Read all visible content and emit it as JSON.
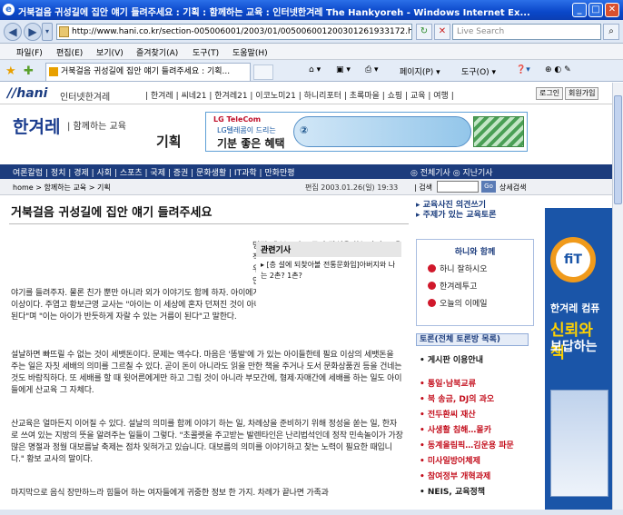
{
  "window": {
    "title": "거북걸음 귀성길에 집안 얘기 들려주세요 : 기획 : 함께하는 교육 : 인터넷한겨레 The Hankyoreh - Windows Internet Ex..."
  },
  "browser": {
    "url": "http://www.hani.co.kr/section-005006001/2003/01/005006001200301261933172.html",
    "search_placeholder": "Live Search",
    "menu": [
      "파일(F)",
      "편집(E)",
      "보기(V)",
      "즐겨찾기(A)",
      "도구(T)",
      "도움말(H)"
    ],
    "tab_title": "거북걸음 귀성길에 집안 얘기 들려주세요 : 기획...",
    "tools": [
      "페이지(P) ▾",
      "도구(O) ▾"
    ]
  },
  "site": {
    "logo": "//hani",
    "logo_sub": "인터넷한겨레",
    "top_links": "| 한겨레 | 씨네21 | 한겨레21 | 이코노미21 | 하니리포터 | 초록마을 | 쇼핑 | 교육 | 여행 |",
    "login": "로그인",
    "join": "회원가입",
    "brand": "한겨레",
    "brand_tag": "| 함께하는 교육",
    "section": "기획",
    "ad": {
      "company": "LG TeleCom",
      "line1": "LG텔레콤이 드리는",
      "line2": "기분 좋은 혜택",
      "circle": "②"
    },
    "categories": "여론칼럼 | 정치 | 경제 | 사회 | 스포츠 | 국제 | 증권 | 문화생활 | IT과학 | 만화만평",
    "cat_right": "◎ 전체기사  ◎ 지난기사",
    "breadcrumb": "home > 함께하는 교육 > 기획",
    "date": "편집 2003.01.26(일) 19:33",
    "search_label": "| 검색",
    "go": "Go",
    "detail_search": "상세검색"
  },
  "article": {
    "headline": "거북걸음 귀성길에 집안 얘기 들려주세요",
    "paragraphs": [
      "명절 때 부모가 조금만 관심을 쏟는다면, 교육적으로 아이들과 유익한 시간을 보낼 수 있다. 우선 차가 막혀 '고생길'이 되는 고향가는 차 안에서 아이들이 어렸을 적 이야기나 집안 이야기를 들려주자. 물론 친가 뿐만 아니라 외가 이야기도 함께 하자. 아이에게 가족이나 조상 이야기는 단순한 흥미거리 이상이다. 주엽고 황보근영 교사는 \"아이는 이 세상에 혼자 던져진 것이 아니라는 것을 알게 되고 공동체 의식을 느끼게 된다\"며 \"이는 아이가 반듯하게 자랄 수 있는 거름이 된다\"고 말한다.",
      "설날하면 빠뜨릴 수 없는 것이 세뱃돈이다. 문제는 액수다. 마음은 '똥발'에 가 있는 아이들한테 필요 이상의 세뱃돈을 주는 일은 자칫 세배의 의미를 그르칠 수 있다. 곧이 돈이 아니라도 읽을 만한 책을 주거나 도서 문화상품권 등을 건네는 것도 바람직하다. 또 세배를 할 때 윗어른에게만 하고 그림 것이 아니라 부모간에, 형제·자매간에 세배를 하는 일도 아이들에게 산교육 그 자체다.",
      "산교육은 얼마든지 이어질 수 있다. 설날의 의미를 함께 이야기 하는 일, 차례상을 준비하기 위해 정성을 쏟는 일, 한자로 쓰여 있는 지방의 뜻을 알려주는 일들이 그렇다. \"초콜렛을 주고받는 발렌타인은 난리법석인데 정작 민속놀이가 가장 많은 명절과 정월 대보름날 축제는 점차 잊혀가고 있습니다. 대보름의 의미를 이야기하고 찾는 노력이 필요한 때입니다.\" 황보 교사의 말이다.",
      "마지막으로 음식 장만하느라 힘들어 하는 여자들에게 귀중한 정보 한 가지. 차례가 끝나면 가족과"
    ],
    "related_title": "관련기사",
    "related_item": "▸ [층 설에 되찾아볼 전통문화입]아버지와 나는 2촌? 1촌?"
  },
  "sidebar": {
    "links": [
      "▸ 교육사진 의견쓰기",
      "▸ 주제가 있는 교육토론"
    ],
    "box_title": "하니와 함께",
    "box_items": [
      "하니 잘하시오",
      "한겨레투고",
      "오늘의 이메일"
    ],
    "forum_title": "토론(전체 토론방 목록)",
    "list": [
      "• 게시판 이용안내",
      "• 통일·남북교류",
      "• 북 송금, DJ의 과오",
      "• 전두환씨 재산",
      "• 사생활 침해…몰카",
      "• 동계올림픽…김운용 파문",
      "• 미사일방어체제",
      "• 참여정부 개혁과제",
      "• NEIS, 교육정책"
    ]
  },
  "right_ad": {
    "brand": "fiT",
    "line1": "한겨레 컴퓨",
    "line2": "신뢰와 책",
    "line3": "보답하는"
  }
}
